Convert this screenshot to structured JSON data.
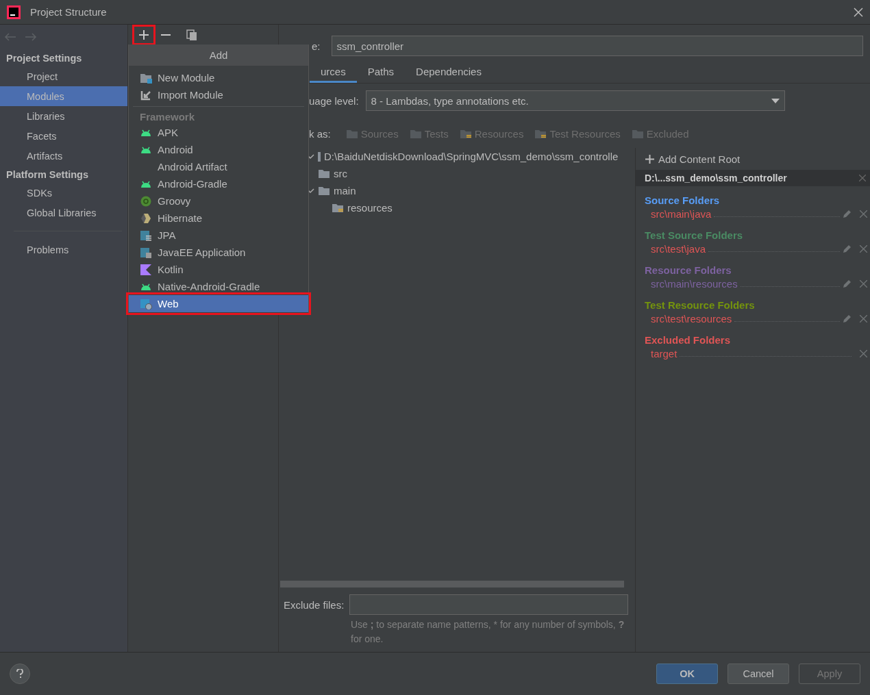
{
  "window": {
    "title": "Project Structure"
  },
  "sidebar": {
    "groups": [
      {
        "title": "Project Settings",
        "items": [
          {
            "label": "Project",
            "selected": false
          },
          {
            "label": "Modules",
            "selected": true
          },
          {
            "label": "Libraries",
            "selected": false
          },
          {
            "label": "Facets",
            "selected": false
          },
          {
            "label": "Artifacts",
            "selected": false
          }
        ]
      },
      {
        "title": "Platform Settings",
        "items": [
          {
            "label": "SDKs",
            "selected": false
          },
          {
            "label": "Global Libraries",
            "selected": false
          }
        ]
      }
    ],
    "footer_items": [
      {
        "label": "Problems",
        "selected": false
      }
    ]
  },
  "toolbar": {
    "add_highlighted": true
  },
  "add_menu": {
    "title": "Add",
    "top_items": [
      {
        "label": "New Module",
        "kind": "module",
        "selected": false,
        "highlighted": false
      },
      {
        "label": "Import Module",
        "kind": "import",
        "selected": false,
        "highlighted": false
      }
    ],
    "section": "Framework",
    "items": [
      {
        "label": "APK",
        "kind": "android",
        "selected": false,
        "highlighted": false
      },
      {
        "label": "Android",
        "kind": "android",
        "selected": false,
        "highlighted": false
      },
      {
        "label": "Android Artifact",
        "kind": "none",
        "selected": false,
        "highlighted": false
      },
      {
        "label": "Android-Gradle",
        "kind": "android",
        "selected": false,
        "highlighted": false
      },
      {
        "label": "Groovy",
        "kind": "groovy",
        "selected": false,
        "highlighted": false
      },
      {
        "label": "Hibernate",
        "kind": "hibernate",
        "selected": false,
        "highlighted": false
      },
      {
        "label": "JPA",
        "kind": "jpa",
        "selected": false,
        "highlighted": false
      },
      {
        "label": "JavaEE Application",
        "kind": "javaee",
        "selected": false,
        "highlighted": false
      },
      {
        "label": "Kotlin",
        "kind": "kotlin",
        "selected": false,
        "highlighted": false
      },
      {
        "label": "Native-Android-Gradle",
        "kind": "android",
        "selected": false,
        "highlighted": false
      },
      {
        "label": "Web",
        "kind": "web",
        "selected": true,
        "highlighted": true
      }
    ]
  },
  "name_field": {
    "label": "e:",
    "value": "ssm_controller"
  },
  "tabs": [
    {
      "label": "urces",
      "selected": true
    },
    {
      "label": "Paths",
      "selected": false
    },
    {
      "label": "Dependencies",
      "selected": false
    }
  ],
  "language_level": {
    "label": "uage level:",
    "value": "8 - Lambdas, type annotations etc."
  },
  "mark_as": {
    "label": "k as:",
    "buttons": [
      {
        "label": "Sources",
        "kind": "source"
      },
      {
        "label": "Tests",
        "kind": "test"
      },
      {
        "label": "Resources",
        "kind": "resource"
      },
      {
        "label": "Test Resources",
        "kind": "testresource"
      },
      {
        "label": "Excluded",
        "kind": "excluded"
      }
    ]
  },
  "tree": [
    {
      "label": "D:\\BaiduNetdiskDownload\\SpringMVC\\ssm_demo\\ssm_controlle",
      "kind": "root",
      "expanded": true,
      "children": [
        {
          "label": "src",
          "kind": "folder"
        },
        {
          "label": "main",
          "kind": "folder",
          "expanded": true,
          "children": [
            {
              "label": "resources",
              "kind": "resource"
            }
          ]
        }
      ]
    }
  ],
  "exclude_files": {
    "label": "Exclude files:",
    "hint": "Use **;** to separate name patterns, * for any number of symbols, **?** for one."
  },
  "content_root": {
    "add_label": "Add Content Root",
    "root": "D:\\...ssm_demo\\ssm_controller",
    "groups": [
      {
        "title": "Source Folders",
        "color": "#589df6",
        "paths": [
          {
            "path": "src\\main\\java",
            "color": "#e05555",
            "editable": true
          }
        ]
      },
      {
        "title": "Test Source Folders",
        "color": "#4a8b63",
        "paths": [
          {
            "path": "src\\test\\java",
            "color": "#e05555",
            "editable": true
          }
        ]
      },
      {
        "title": "Resource Folders",
        "color": "#7d62a0",
        "paths": [
          {
            "path": "src\\main\\resources",
            "color": "#7d62a0",
            "editable": true
          }
        ]
      },
      {
        "title": "Test Resource Folders",
        "color": "#74940d",
        "paths": [
          {
            "path": "src\\test\\resources",
            "color": "#e05555",
            "editable": true
          }
        ]
      },
      {
        "title": "Excluded Folders",
        "color": "#e05555",
        "paths": [
          {
            "path": "target",
            "color": "#e05555",
            "editable": false
          }
        ]
      }
    ]
  },
  "buttons": [
    {
      "label": "OK",
      "kind": "primary"
    },
    {
      "label": "Cancel",
      "kind": "normal"
    },
    {
      "label": "Apply",
      "kind": "disabled"
    }
  ]
}
